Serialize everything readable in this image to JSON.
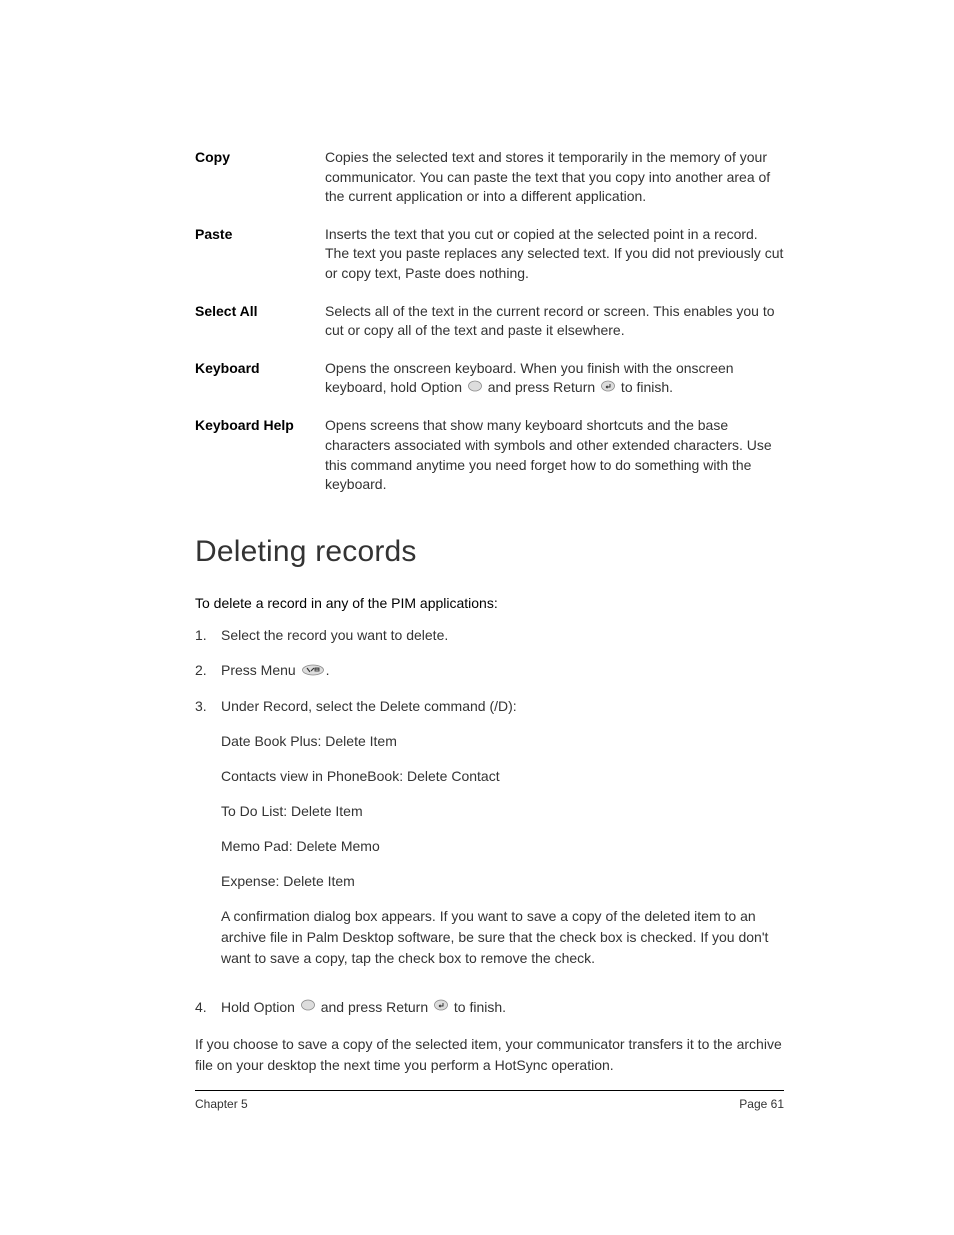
{
  "definitions": [
    {
      "term": "Copy",
      "desc": "Copies the selected text and stores it temporarily in the memory of your communicator. You can paste the text that you copy into another area of the current application or into a different application."
    },
    {
      "term": "Paste",
      "desc": "Inserts the text that you cut or copied at the selected point in a record. The text you paste replaces any selected text. If you did not previously cut or copy text, Paste does nothing."
    },
    {
      "term": "Select All",
      "desc": "Selects all of the text in the current record or screen. This enables you to cut or copy all of the text and paste it elsewhere."
    },
    {
      "term": "Keyboard",
      "desc_parts": {
        "pre": "Opens the onscreen keyboard. When you finish with the onscreen keyboard, hold Option ",
        "mid": " and press Return ",
        "post": " to finish."
      }
    },
    {
      "term": "Keyboard Help",
      "desc": "Opens screens that show many keyboard shortcuts and the base characters associated with symbols and other extended characters. Use this command anytime you need forget how to do something with the keyboard."
    }
  ],
  "section_heading": "Deleting records",
  "intro": "To delete a record in any of the PIM applications:",
  "steps": {
    "s1": {
      "num": "1.",
      "text": "Select the record you want to delete."
    },
    "s2": {
      "num": "2.",
      "pre": "Press Menu ",
      "post": "."
    },
    "s3": {
      "num": "3.",
      "lead": "Under Record, select the Delete command (/D):",
      "items": [
        "Date Book Plus: Delete Item",
        "Contacts view in PhoneBook: Delete Contact",
        "To Do List: Delete Item",
        "Memo Pad: Delete Memo",
        "Expense: Delete Item"
      ],
      "confirm": "A confirmation dialog box appears. If you want to save a copy of the deleted item to an archive file in Palm Desktop software, be sure that the check box is checked. If you don't want to save a copy, tap the check box to remove the check."
    },
    "s4": {
      "num": "4.",
      "pre": "Hold Option ",
      "mid": " and press Return ",
      "post": " to finish."
    }
  },
  "closing": "If you choose to save a copy of the selected item, your communicator transfers it to the archive file on your desktop the next time you perform a HotSync operation.",
  "footer": {
    "left": "Chapter 5",
    "right": "Page 61"
  }
}
